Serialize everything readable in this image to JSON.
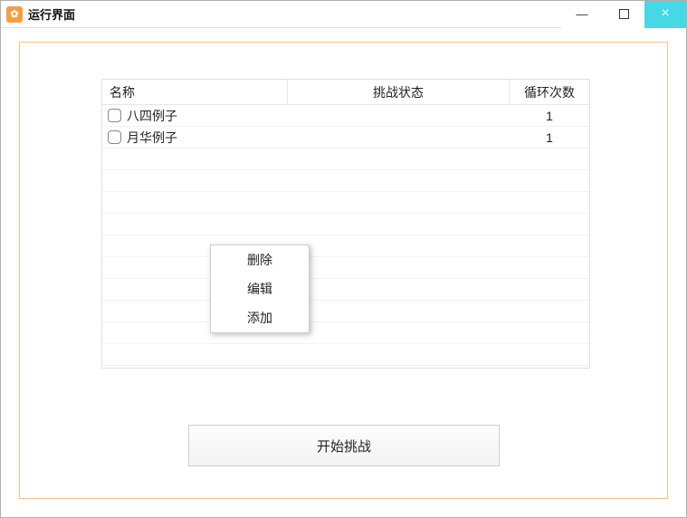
{
  "window": {
    "title": "运行界面",
    "iconGlyph": "✿"
  },
  "columns": {
    "name": "名称",
    "status": "挑战状态",
    "loop": "循环次数"
  },
  "rows": [
    {
      "checked": false,
      "name": "八四例子",
      "status": "",
      "loop": "1"
    },
    {
      "checked": false,
      "name": "月华例子",
      "status": "",
      "loop": "1"
    }
  ],
  "emptyRowCount": 10,
  "contextMenu": {
    "items": [
      {
        "label": "删除"
      },
      {
        "label": "编辑"
      },
      {
        "label": "添加"
      }
    ]
  },
  "startButton": {
    "label": "开始挑战"
  }
}
